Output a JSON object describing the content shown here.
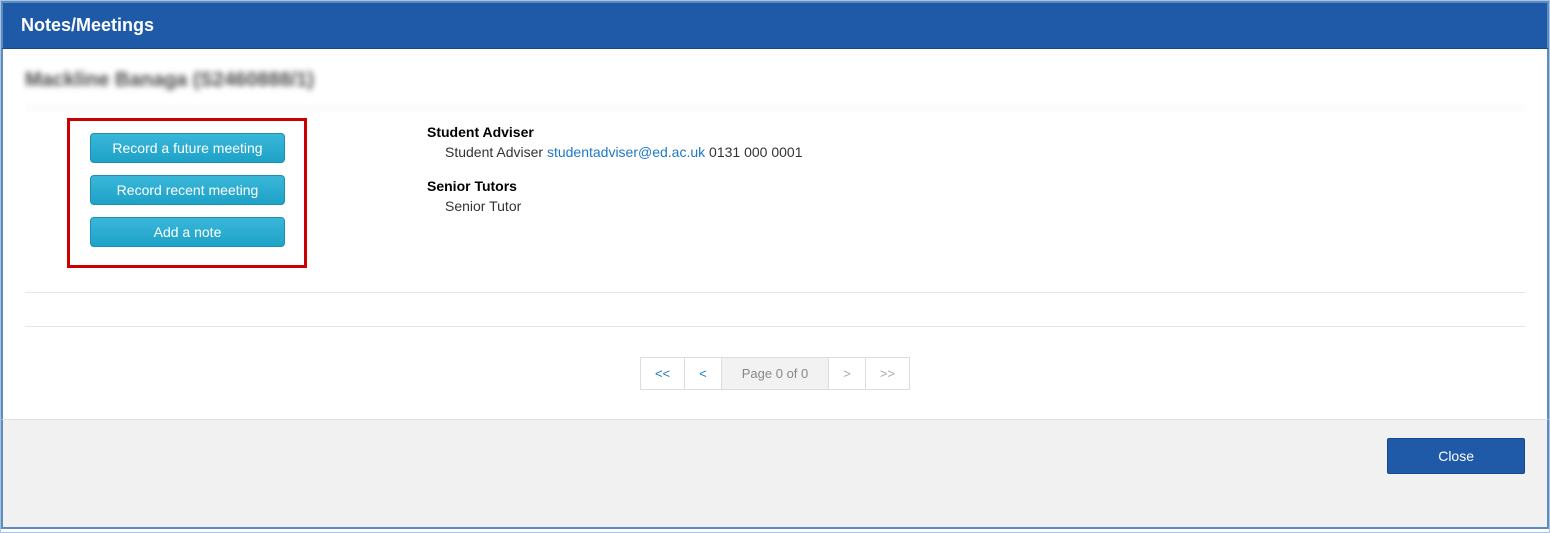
{
  "header": {
    "title": "Notes/Meetings"
  },
  "student": {
    "name_display": "Mackline Banaga (S2460888/1)"
  },
  "actions": {
    "record_future": "Record a future meeting",
    "record_recent": "Record recent meeting",
    "add_note": "Add a note"
  },
  "adviser": {
    "heading": "Student Adviser",
    "role_label": "Student Adviser",
    "email": "studentadviser@ed.ac.uk",
    "phone": "0131 000 0001"
  },
  "senior_tutors": {
    "heading": "Senior Tutors",
    "role_label": "Senior Tutor"
  },
  "pager": {
    "first": "<<",
    "prev": "<",
    "info": "Page 0 of 0",
    "next": ">",
    "last": ">>"
  },
  "footer": {
    "close": "Close"
  }
}
